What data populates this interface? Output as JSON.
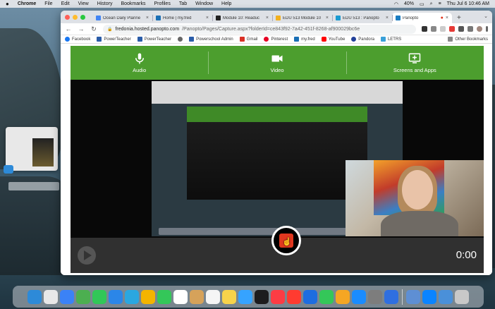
{
  "menubar": {
    "apple": "",
    "app": "Chrome",
    "items": [
      "File",
      "Edit",
      "View",
      "History",
      "Bookmarks",
      "Profiles",
      "Tab",
      "Window",
      "Help"
    ],
    "battery": "40%",
    "clock": "Thu Jul 6  10:46 AM"
  },
  "tabs": [
    {
      "title": "Ocean Daily Planne",
      "color": "#4285f4",
      "active": false
    },
    {
      "title": "Home | my.fred",
      "color": "#1a6fb5",
      "active": false
    },
    {
      "title": "Module 10: Readuc",
      "color": "#222222",
      "active": false
    },
    {
      "title": "EDU 513 Module 10",
      "color": "#f2b01e",
      "active": false
    },
    {
      "title": "EDU 513 : Panopto",
      "color": "#1b9bd1",
      "active": false
    },
    {
      "title": "Panopto",
      "color": "#1b7cc1",
      "active": true
    }
  ],
  "newtab": "+",
  "omnibox": {
    "host": "fredonia.hosted.panopto.com",
    "path": "/Panopto/Pages/Capture.aspx?folderId=ce843f92-7a42-451f-8268-af900029bc6e"
  },
  "bookmarks": [
    {
      "label": "Facebook",
      "color": "#1877f2"
    },
    {
      "label": "PowerTeacher",
      "color": "#2a5ca8"
    },
    {
      "label": "PowerTeacher",
      "color": "#2a5ca8"
    },
    {
      "label": "",
      "color": "#666666"
    },
    {
      "label": "Powerschool Admin",
      "color": "#2a5ca8"
    },
    {
      "label": "Gmail",
      "color": "#d93025"
    },
    {
      "label": "Pinterest",
      "color": "#e60023"
    },
    {
      "label": "my.fred",
      "color": "#1a6fb5"
    },
    {
      "label": "YouTube",
      "color": "#ff0000"
    },
    {
      "label": "Pandora",
      "color": "#224099"
    },
    {
      "label": "LETRS",
      "color": "#3aa0d8"
    }
  ],
  "other_bookmarks": "Other Bookmarks",
  "capture": {
    "sources": [
      {
        "label": "Audio",
        "icon": "microphone-icon"
      },
      {
        "label": "Video",
        "icon": "video-camera-icon"
      },
      {
        "label": "Screens and Apps",
        "icon": "screen-add-icon"
      }
    ],
    "time": "0:00",
    "accent": "#4c9e2e",
    "record_color": "#e0371f"
  },
  "dock_colors": [
    "#2d8ad8",
    "#e8e8e8",
    "#3b82f6",
    "#4caf50",
    "#31c758",
    "#2b86e8",
    "#2aa7e0",
    "#f4b400",
    "#34c759",
    "#ffffff",
    "#d6a25a",
    "#f5f5f5",
    "#f7d34b",
    "#36a3ff",
    "#1c1c1e",
    "#fc3c44",
    "#ff3b30",
    "#1d6de0",
    "#34c759",
    "#f5a623",
    "#1a8cff",
    "#7d7d7d",
    "#2f6fe0",
    "#5e8fd4",
    "#0a84ff",
    "#4a90d9",
    "#c8c8c8"
  ]
}
